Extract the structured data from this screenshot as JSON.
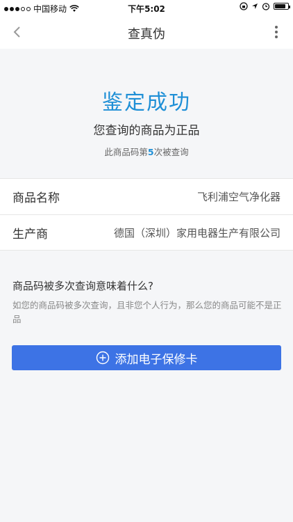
{
  "status_bar": {
    "carrier": "中国移动",
    "time": "下午5:02",
    "battery_level": 0.85
  },
  "nav": {
    "title": "查真伪",
    "icons": [
      "chevron-left-icon",
      "more-vertical-icon"
    ]
  },
  "result": {
    "title": "鉴定成功",
    "subtitle": "您查询的商品为正品",
    "count_prefix": "此商品码第",
    "count_number": "5",
    "count_suffix": "次被查询"
  },
  "info_rows": [
    {
      "label": "商品名称",
      "value": "飞利浦空气净化器"
    },
    {
      "label": "生产商",
      "value": "德国（深圳）家用电器生产有限公司"
    }
  ],
  "faq": {
    "question": "商品码被多次查询意味着什么?",
    "answer": "如您的商品码被多次查询，且非您个人行为，那么您的商品可能不是正品"
  },
  "button": {
    "label": "添加电子保修卡",
    "icon": "plus-circle-icon"
  },
  "colors": {
    "accent": "#1e8fd6",
    "button": "#3d73e5",
    "background": "#f5f6f8"
  }
}
